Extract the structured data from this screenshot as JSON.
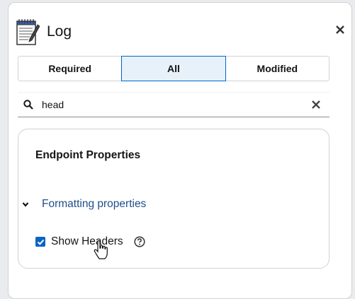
{
  "panel": {
    "title": "Log",
    "icon": "notepad-icon",
    "close_icon": "close-icon"
  },
  "filter_toggle": {
    "options": [
      {
        "label": "Required",
        "active": false
      },
      {
        "label": "All",
        "active": true
      },
      {
        "label": "Modified",
        "active": false
      }
    ]
  },
  "search": {
    "value": "head",
    "icon": "search-icon",
    "clear_icon": "clear-icon"
  },
  "card": {
    "title": "Endpoint Properties",
    "section": {
      "label": "Formatting properties",
      "expanded": true,
      "icon": "chevron-down-icon"
    },
    "field": {
      "label": "Show Headers",
      "checked": true,
      "help_icon": "help-icon"
    }
  },
  "colors": {
    "active_toggle_bg": "#e7f1fa",
    "active_toggle_border": "#0066cc",
    "link": "#1f4e8a",
    "checkbox": "#0b63c6"
  }
}
